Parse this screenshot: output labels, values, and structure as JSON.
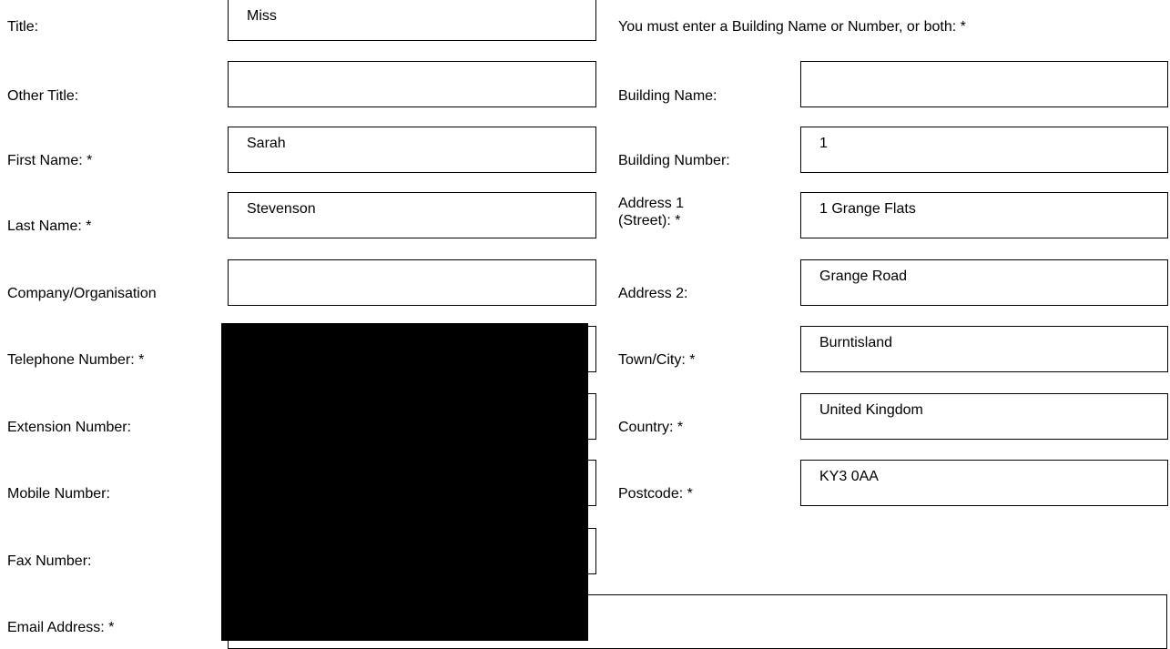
{
  "left": {
    "title": {
      "label": "Title:",
      "value": "Miss"
    },
    "other_title": {
      "label": "Other Title:",
      "value": ""
    },
    "first_name": {
      "label": "First Name: *",
      "value": "Sarah"
    },
    "last_name": {
      "label": "Last Name: *",
      "value": "Stevenson"
    },
    "company": {
      "label": "Company/Organisation",
      "value": ""
    },
    "telephone": {
      "label": "Telephone Number: *",
      "value": ""
    },
    "extension": {
      "label": "Extension Number:",
      "value": ""
    },
    "mobile": {
      "label": "Mobile Number:",
      "value": ""
    },
    "fax": {
      "label": "Fax Number:",
      "value": ""
    },
    "email": {
      "label": "Email Address: *",
      "value": ""
    }
  },
  "right": {
    "note": "You must enter a Building Name or Number, or both: *",
    "building_name": {
      "label": "Building Name:",
      "value": ""
    },
    "building_number": {
      "label": "Building Number:",
      "value": "1"
    },
    "address1": {
      "label_line1": "Address 1",
      "label_line2": "(Street): *",
      "value": "1 Grange Flats"
    },
    "address2": {
      "label": "Address 2:",
      "value": "Grange Road"
    },
    "town": {
      "label": "Town/City: *",
      "value": "Burntisland"
    },
    "country": {
      "label": "Country: *",
      "value": "United Kingdom"
    },
    "postcode": {
      "label": "Postcode: *",
      "value": "KY3 0AA"
    }
  },
  "redaction_color": "#000000"
}
